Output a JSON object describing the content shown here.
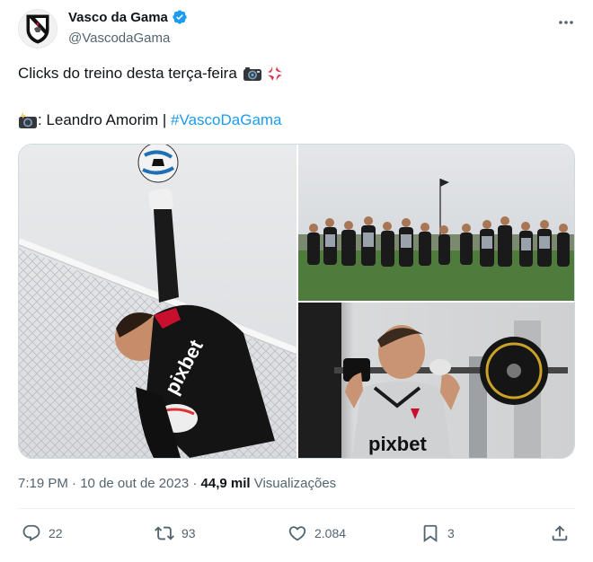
{
  "author": {
    "display_name": "Vasco da Gama",
    "handle": "@VascodaGama",
    "verified": true,
    "avatar_icon": "vasco-crest-icon"
  },
  "tweet": {
    "line1": "Clicks do treino desta terça-feira",
    "line1_emojis": [
      "camera-icon",
      "anger-icon"
    ],
    "line2_prefix": ": Leandro Amorim | ",
    "line2_prefix_emoji": "camera-flash-icon",
    "hashtag": "#VascoDaGama"
  },
  "media": [
    {
      "alt_icon": "goalkeeper-photo"
    },
    {
      "alt_icon": "team-huddle-photo"
    },
    {
      "alt_icon": "gym-squat-photo"
    }
  ],
  "meta": {
    "time": "7:19 PM",
    "sep": " · ",
    "date": "10 de out de 2023",
    "views_count": "44,9 mil",
    "views_label": "Visualizações"
  },
  "actions": {
    "replies": "22",
    "retweets": "93",
    "likes": "2.084",
    "bookmarks": "3"
  },
  "colors": {
    "accent": "#1d9bf0",
    "text": "#0f1419",
    "muted": "#536471"
  }
}
